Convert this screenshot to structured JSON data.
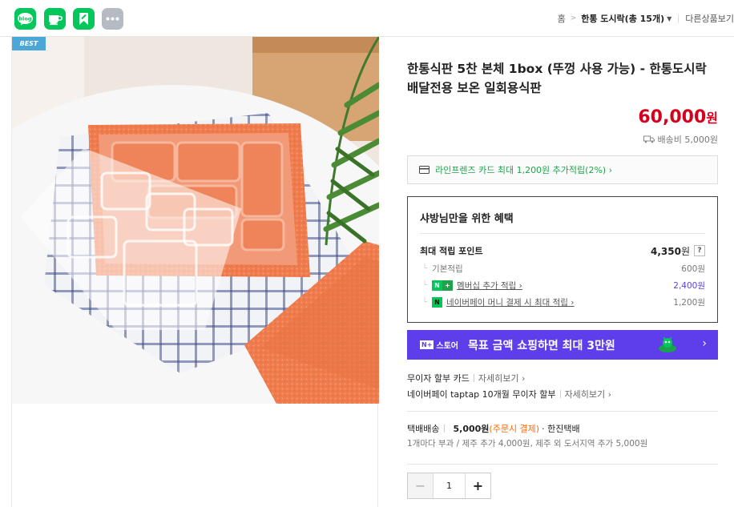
{
  "share": {
    "blog_label": "blog"
  },
  "breadcrumb": {
    "home": "홈",
    "current": "한통 도시락(총 15개)",
    "other": "다른상품보기"
  },
  "product": {
    "badge": "BEST",
    "title": "한통식판 5찬 본체 1box (뚜껑 사용 가능) - 한통도시락 배달전용 보온 일회용식판",
    "price": "60,000",
    "price_unit": "원",
    "shipping_fee": "배송비 5,000원"
  },
  "card_promo": {
    "text": "라인프렌즈 카드 최대 1,200원 추가적립(2%) ›"
  },
  "benefit": {
    "title": "샤방님만을 위한 혜택",
    "max_points_label": "최대 적립 포인트",
    "max_points_value": "4,350",
    "max_points_unit": "원",
    "help": "?",
    "rows": [
      {
        "label": "기본적립",
        "value": "600원"
      },
      {
        "label": "멤버십 추가 적립 ›",
        "value": "2,400원"
      },
      {
        "label": "네이버페이 머니 결제 시 최대 적립 ›",
        "value": "1,200원"
      }
    ],
    "nplus_n": "N",
    "nplus_plus": "+",
    "npay_letter": "N"
  },
  "banner": {
    "logo_n": "N+",
    "logo_text": "스토어",
    "message": "목표 금액 쇼핑하면 최대 3만원",
    "chevron": "›"
  },
  "installment": {
    "line1_label": "무이자 할부 카드",
    "line1_more": "자세히보기 ›",
    "line2_label": "네이버페이 taptap 10개월 무이자 할부",
    "line2_more": "자세히보기 ›"
  },
  "delivery": {
    "method": "택배배송",
    "fee": "5,000원",
    "fee_note": "(주문시 결제)",
    "carrier": "· 한진택배",
    "extra": "1개마다 부과 / 제주 추가 4,000원, 제주 외 도서지역 추가 5,000원"
  },
  "quantity": {
    "minus": "−",
    "value": "1",
    "plus": "+"
  },
  "colors": {
    "brand_green": "#03c75a",
    "price_red": "#d6001c",
    "banner_purple": "#5d3eea",
    "membership_purple": "#5c43d6",
    "note_orange": "#ff6a00"
  }
}
